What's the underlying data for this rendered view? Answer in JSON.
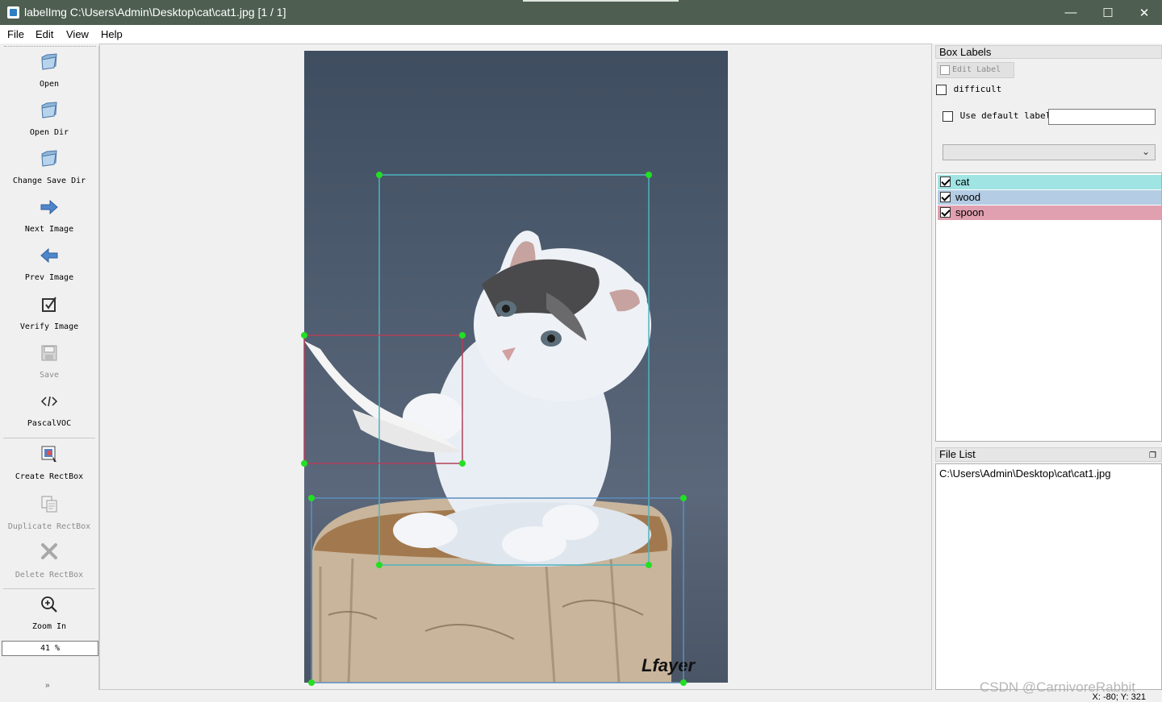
{
  "window": {
    "title": "labelImg C:\\Users\\Admin\\Desktop\\cat\\cat1.jpg [1 / 1]",
    "buttons": [
      "—",
      "☐",
      "✕"
    ]
  },
  "menu": [
    "File",
    "Edit",
    "View",
    "Help"
  ],
  "toolbar": {
    "items": [
      {
        "label": "Open",
        "icon": "folder-icon",
        "enabled": true
      },
      {
        "label": "Open Dir",
        "icon": "folder-icon",
        "enabled": true
      },
      {
        "label": "Change Save Dir",
        "icon": "folder-icon",
        "enabled": true
      },
      {
        "label": "Next Image",
        "icon": "arrow-right-icon",
        "enabled": true
      },
      {
        "label": "Prev Image",
        "icon": "arrow-left-icon",
        "enabled": true
      },
      {
        "label": "Verify Image",
        "icon": "checkbox-icon",
        "enabled": true
      },
      {
        "label": "Save",
        "icon": "save-icon",
        "enabled": false
      },
      {
        "label": "PascalVOC",
        "icon": "code-icon",
        "enabled": true
      },
      {
        "label": "Create RectBox",
        "icon": "create-rect-icon",
        "enabled": true
      },
      {
        "label": "Duplicate RectBox",
        "icon": "duplicate-icon",
        "enabled": false
      },
      {
        "label": "Delete RectBox",
        "icon": "delete-icon",
        "enabled": false
      },
      {
        "label": "Zoom In",
        "icon": "zoom-in-icon",
        "enabled": true
      }
    ],
    "zoom_value": "41 %",
    "extension": "»"
  },
  "canvas": {
    "image_text": "Lfayer",
    "boxes": [
      {
        "label": "cat",
        "color": "#4fb3bf"
      },
      {
        "label": "spoon",
        "color": "#b0405a"
      },
      {
        "label": "wood",
        "color": "#5a8fbf"
      }
    ],
    "handle_color": "#22e022"
  },
  "box_labels": {
    "title": "Box Labels",
    "edit_label": "Edit Label",
    "difficult": "difficult",
    "use_default_label": "Use default label",
    "default_label_value": "",
    "items": [
      {
        "name": "cat",
        "color": "#a0e4e4",
        "checked": true
      },
      {
        "name": "wood",
        "color": "#b4cde4",
        "checked": true
      },
      {
        "name": "spoon",
        "color": "#e0a0b0",
        "checked": true
      }
    ]
  },
  "file_list": {
    "title": "File List",
    "items": [
      "C:\\Users\\Admin\\Desktop\\cat\\cat1.jpg"
    ]
  },
  "status": {
    "coords": "X: -80; Y: 321"
  },
  "watermark": "CSDN @CarnivoreRabbit"
}
